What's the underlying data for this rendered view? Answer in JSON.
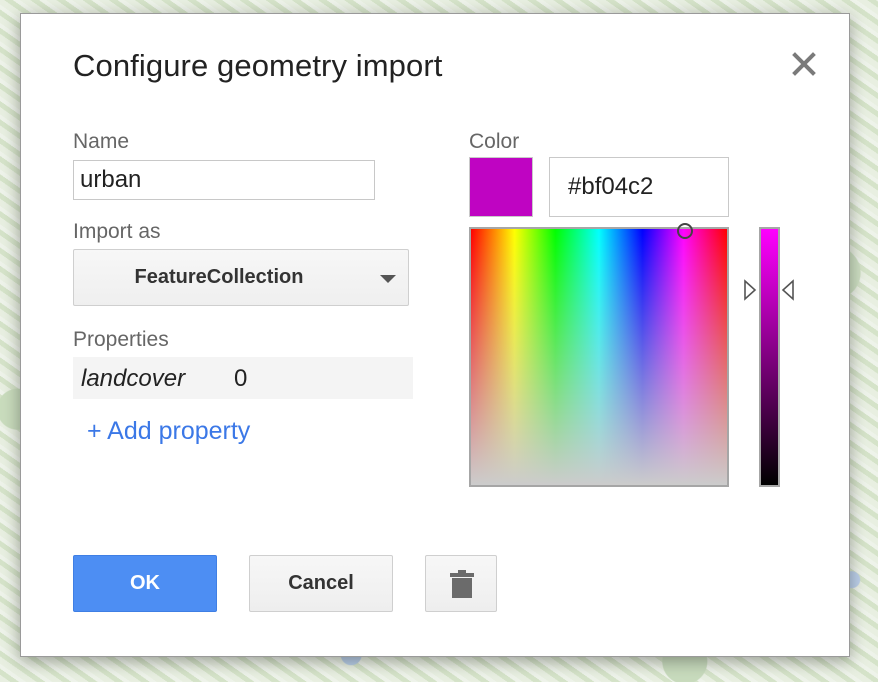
{
  "dialog": {
    "title": "Configure geometry import",
    "close_icon": "close-icon"
  },
  "name": {
    "label": "Name",
    "value": "urban"
  },
  "import_as": {
    "label": "Import as",
    "selected": "FeatureCollection",
    "arrow_icon": "dropdown-arrow-icon"
  },
  "properties": {
    "label": "Properties",
    "rows": [
      {
        "key": "landcover",
        "value": "0"
      }
    ],
    "add_label": "+ Add property"
  },
  "color": {
    "label": "Color",
    "hex": "#bf04c2",
    "swatch": "#bf04c2"
  },
  "buttons": {
    "ok": "OK",
    "cancel": "Cancel",
    "delete_icon": "trash-icon"
  },
  "colors": {
    "accent": "#4d8ef3",
    "link": "#3b78e7"
  }
}
